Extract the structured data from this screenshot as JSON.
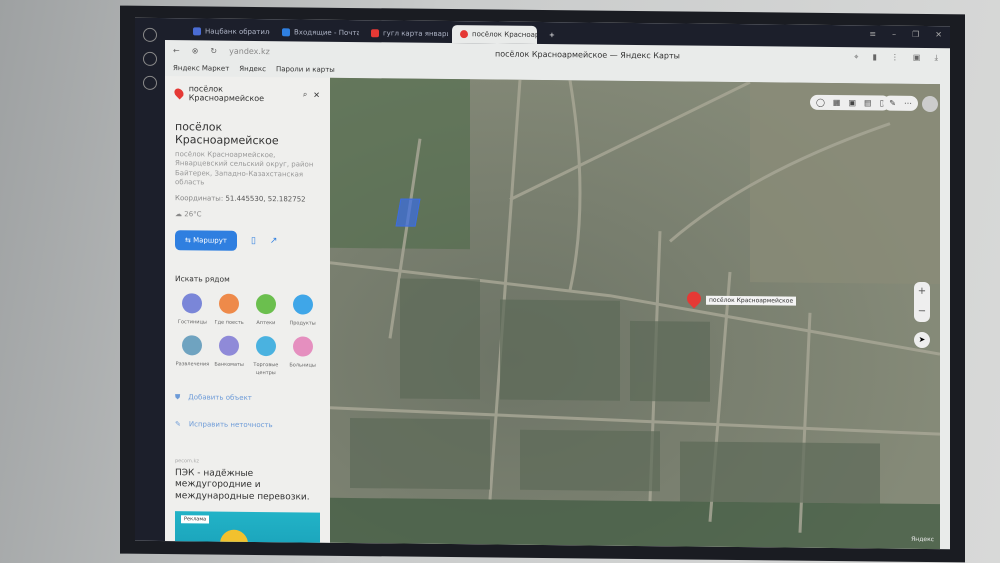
{
  "browser": {
    "tabs": [
      {
        "label": "Нацбанк обратился к ка"
      },
      {
        "label": "Входящие - Почта Mail.ru"
      },
      {
        "label": "гугл карта январцевский"
      },
      {
        "label": "посёлок Красноармейск"
      }
    ],
    "url": "yandex.kz",
    "page_title": "посёлок Красноармейское — Яндекс Карты",
    "bookmarks": [
      "Яндекс Маркет",
      "Яндекс",
      "Пароли и карты"
    ]
  },
  "panel": {
    "search_value": "посёлок Красноармейское",
    "title": "посёлок Красноармейское",
    "address": "посёлок Красноармейское, Январцевский сельский округ, район Байтерек, Западно-Казахстанская область",
    "coords_label": "Координаты:",
    "coords_value": "51.445530, 52.182752",
    "temperature": "26°C",
    "route_label": "Маршрут",
    "nearby_title": "Искать рядом",
    "categories": [
      {
        "label": "Гостиницы",
        "color": "#7a86d8"
      },
      {
        "label": "Где поесть",
        "color": "#ee8a4a"
      },
      {
        "label": "Аптеки",
        "color": "#6bbf4e"
      },
      {
        "label": "Продукты",
        "color": "#3fa6e8"
      },
      {
        "label": "Развлечения",
        "color": "#6fa3c0"
      },
      {
        "label": "Банкоматы",
        "color": "#8f8ad8"
      },
      {
        "label": "Торговые центры",
        "color": "#4ab2e0"
      },
      {
        "label": "Больницы",
        "color": "#e58fbf"
      }
    ],
    "add_object": "Добавить объект",
    "fix_error": "Исправить неточность",
    "ad": {
      "source": "pecom.kz",
      "text": "ПЭК - надёжные междугородние и международные перевозки.",
      "badge": "Реклама"
    }
  },
  "map": {
    "pin_label": "посёлок Красноармейское",
    "attribution": "Яндекс",
    "zoom_in": "+",
    "zoom_out": "−"
  }
}
